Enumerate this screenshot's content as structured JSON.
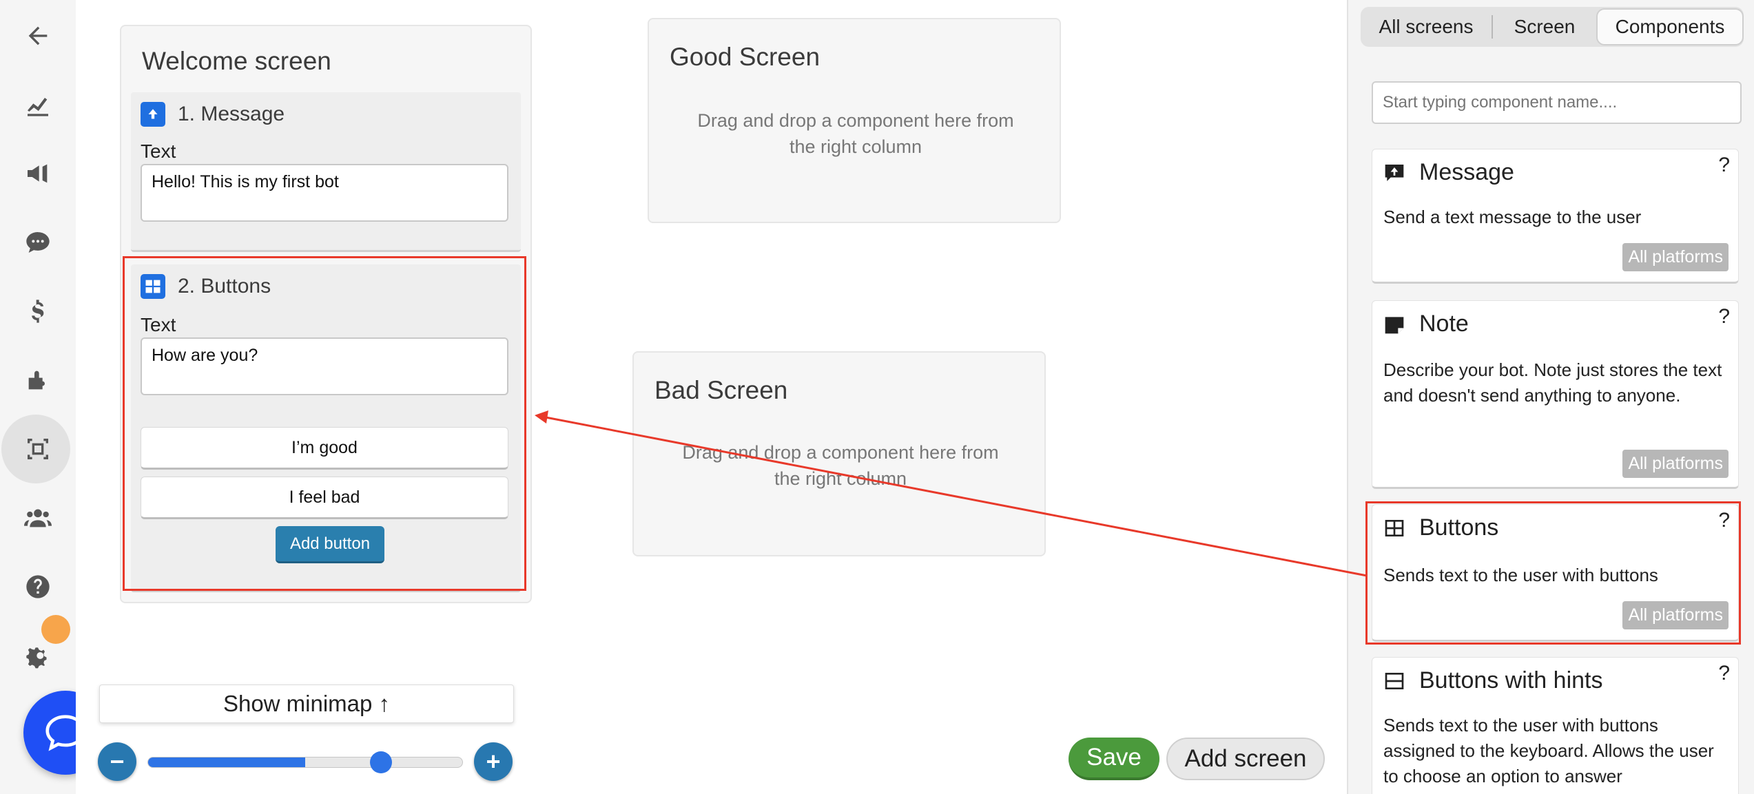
{
  "canvas": {
    "screens": [
      {
        "title": "Welcome screen",
        "components": [
          {
            "index_label": "1. Message",
            "field_label": "Text",
            "text_value": "Hello! This is my first bot"
          },
          {
            "index_label": "2. Buttons",
            "field_label": "Text",
            "text_value": "How are you?",
            "buttons": [
              "I’m good",
              "I feel bad"
            ],
            "add_button_label": "Add button"
          }
        ]
      },
      {
        "title": "Good Screen",
        "empty_hint": "Drag and drop a component here from the right column"
      },
      {
        "title": "Bad Screen",
        "empty_hint": "Drag and drop a component here from the right column"
      }
    ],
    "minimap_label": "Show minimap ↑",
    "zoom": {
      "level": 0.5,
      "minus": "−",
      "plus": "+"
    },
    "save_label": "Save",
    "add_screen_label": "Add screen"
  },
  "right_panel": {
    "tabs": [
      "All screens",
      "Screen",
      "Components"
    ],
    "active_tab": "Components",
    "search_placeholder": "Start typing component name....",
    "components": [
      {
        "icon": "message-upload-icon",
        "name": "Message",
        "description": "Send a text message to the user",
        "platform": "All platforms",
        "help": "?"
      },
      {
        "icon": "note-icon",
        "name": "Note",
        "description": "Describe your bot. Note just stores the text and doesn't send anything to anyone.",
        "platform": "All platforms",
        "help": "?"
      },
      {
        "icon": "buttons-grid-icon",
        "name": "Buttons",
        "description": "Sends text to the user with buttons",
        "platform": "All platforms",
        "help": "?"
      },
      {
        "icon": "buttons-hints-icon",
        "name": "Buttons with hints",
        "description": "Sends text to the user with buttons assigned to the keyboard. Allows the user to choose an option to answer",
        "platform": "",
        "help": "?"
      }
    ]
  },
  "colors": {
    "accent_blue": "#2878b0",
    "highlight_red": "#e8392a",
    "save_green": "#4b9a3c",
    "badge_orange": "#f7a54b"
  }
}
